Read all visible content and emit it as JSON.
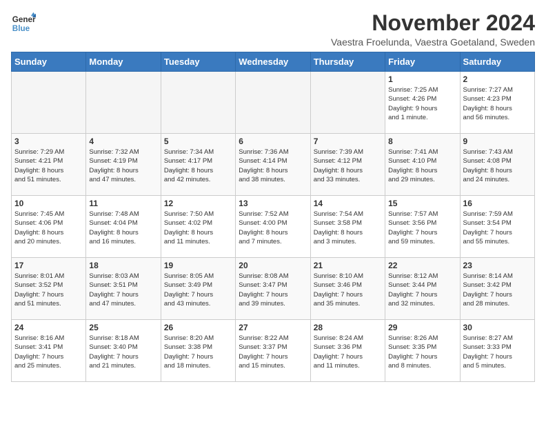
{
  "logo": {
    "name": "GeneralBlue",
    "line1": "General",
    "line2": "Blue"
  },
  "title": "November 2024",
  "subtitle": "Vaestra Froelunda, Vaestra Goetaland, Sweden",
  "days_header": [
    "Sunday",
    "Monday",
    "Tuesday",
    "Wednesday",
    "Thursday",
    "Friday",
    "Saturday"
  ],
  "weeks": [
    [
      {
        "day": "",
        "info": ""
      },
      {
        "day": "",
        "info": ""
      },
      {
        "day": "",
        "info": ""
      },
      {
        "day": "",
        "info": ""
      },
      {
        "day": "",
        "info": ""
      },
      {
        "day": "1",
        "info": "Sunrise: 7:25 AM\nSunset: 4:26 PM\nDaylight: 9 hours\nand 1 minute."
      },
      {
        "day": "2",
        "info": "Sunrise: 7:27 AM\nSunset: 4:23 PM\nDaylight: 8 hours\nand 56 minutes."
      }
    ],
    [
      {
        "day": "3",
        "info": "Sunrise: 7:29 AM\nSunset: 4:21 PM\nDaylight: 8 hours\nand 51 minutes."
      },
      {
        "day": "4",
        "info": "Sunrise: 7:32 AM\nSunset: 4:19 PM\nDaylight: 8 hours\nand 47 minutes."
      },
      {
        "day": "5",
        "info": "Sunrise: 7:34 AM\nSunset: 4:17 PM\nDaylight: 8 hours\nand 42 minutes."
      },
      {
        "day": "6",
        "info": "Sunrise: 7:36 AM\nSunset: 4:14 PM\nDaylight: 8 hours\nand 38 minutes."
      },
      {
        "day": "7",
        "info": "Sunrise: 7:39 AM\nSunset: 4:12 PM\nDaylight: 8 hours\nand 33 minutes."
      },
      {
        "day": "8",
        "info": "Sunrise: 7:41 AM\nSunset: 4:10 PM\nDaylight: 8 hours\nand 29 minutes."
      },
      {
        "day": "9",
        "info": "Sunrise: 7:43 AM\nSunset: 4:08 PM\nDaylight: 8 hours\nand 24 minutes."
      }
    ],
    [
      {
        "day": "10",
        "info": "Sunrise: 7:45 AM\nSunset: 4:06 PM\nDaylight: 8 hours\nand 20 minutes."
      },
      {
        "day": "11",
        "info": "Sunrise: 7:48 AM\nSunset: 4:04 PM\nDaylight: 8 hours\nand 16 minutes."
      },
      {
        "day": "12",
        "info": "Sunrise: 7:50 AM\nSunset: 4:02 PM\nDaylight: 8 hours\nand 11 minutes."
      },
      {
        "day": "13",
        "info": "Sunrise: 7:52 AM\nSunset: 4:00 PM\nDaylight: 8 hours\nand 7 minutes."
      },
      {
        "day": "14",
        "info": "Sunrise: 7:54 AM\nSunset: 3:58 PM\nDaylight: 8 hours\nand 3 minutes."
      },
      {
        "day": "15",
        "info": "Sunrise: 7:57 AM\nSunset: 3:56 PM\nDaylight: 7 hours\nand 59 minutes."
      },
      {
        "day": "16",
        "info": "Sunrise: 7:59 AM\nSunset: 3:54 PM\nDaylight: 7 hours\nand 55 minutes."
      }
    ],
    [
      {
        "day": "17",
        "info": "Sunrise: 8:01 AM\nSunset: 3:52 PM\nDaylight: 7 hours\nand 51 minutes."
      },
      {
        "day": "18",
        "info": "Sunrise: 8:03 AM\nSunset: 3:51 PM\nDaylight: 7 hours\nand 47 minutes."
      },
      {
        "day": "19",
        "info": "Sunrise: 8:05 AM\nSunset: 3:49 PM\nDaylight: 7 hours\nand 43 minutes."
      },
      {
        "day": "20",
        "info": "Sunrise: 8:08 AM\nSunset: 3:47 PM\nDaylight: 7 hours\nand 39 minutes."
      },
      {
        "day": "21",
        "info": "Sunrise: 8:10 AM\nSunset: 3:46 PM\nDaylight: 7 hours\nand 35 minutes."
      },
      {
        "day": "22",
        "info": "Sunrise: 8:12 AM\nSunset: 3:44 PM\nDaylight: 7 hours\nand 32 minutes."
      },
      {
        "day": "23",
        "info": "Sunrise: 8:14 AM\nSunset: 3:42 PM\nDaylight: 7 hours\nand 28 minutes."
      }
    ],
    [
      {
        "day": "24",
        "info": "Sunrise: 8:16 AM\nSunset: 3:41 PM\nDaylight: 7 hours\nand 25 minutes."
      },
      {
        "day": "25",
        "info": "Sunrise: 8:18 AM\nSunset: 3:40 PM\nDaylight: 7 hours\nand 21 minutes."
      },
      {
        "day": "26",
        "info": "Sunrise: 8:20 AM\nSunset: 3:38 PM\nDaylight: 7 hours\nand 18 minutes."
      },
      {
        "day": "27",
        "info": "Sunrise: 8:22 AM\nSunset: 3:37 PM\nDaylight: 7 hours\nand 15 minutes."
      },
      {
        "day": "28",
        "info": "Sunrise: 8:24 AM\nSunset: 3:36 PM\nDaylight: 7 hours\nand 11 minutes."
      },
      {
        "day": "29",
        "info": "Sunrise: 8:26 AM\nSunset: 3:35 PM\nDaylight: 7 hours\nand 8 minutes."
      },
      {
        "day": "30",
        "info": "Sunrise: 8:27 AM\nSunset: 3:33 PM\nDaylight: 7 hours\nand 5 minutes."
      }
    ]
  ]
}
